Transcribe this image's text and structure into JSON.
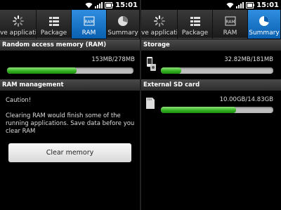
{
  "status": {
    "time": "15:01"
  },
  "tabs": [
    {
      "label": "Active applications",
      "icon": "loading-spinner-icon"
    },
    {
      "label": "Package",
      "icon": "package-list-icon"
    },
    {
      "label": "RAM",
      "icon": "ram-chip-icon"
    },
    {
      "label": "Summary",
      "icon": "pie-chart-icon"
    }
  ],
  "left": {
    "active_tab": "RAM",
    "ram_section": {
      "title": "Random access memory (RAM)",
      "value": "153MB/278MB",
      "used_fraction": 0.55
    },
    "management": {
      "title": "RAM management",
      "caution": "Caution!",
      "message": "Clearing RAM would finish some of the running applications. Save data before you clear RAM",
      "button_label": "Clear memory"
    }
  },
  "right": {
    "active_tab": "Summary",
    "storage": {
      "title": "Storage",
      "value": "32.82MB/181MB",
      "used_fraction": 0.18,
      "icon": "phone-storage-icon"
    },
    "sd_card": {
      "title": "External SD card",
      "value": "10.00GB/14.83GB",
      "used_fraction": 0.67,
      "icon": "sd-card-icon"
    }
  },
  "colors": {
    "tab_active": "#1a7ad0",
    "bar_fill": "#2fae1e",
    "bar_track": "#bdbdbd"
  }
}
